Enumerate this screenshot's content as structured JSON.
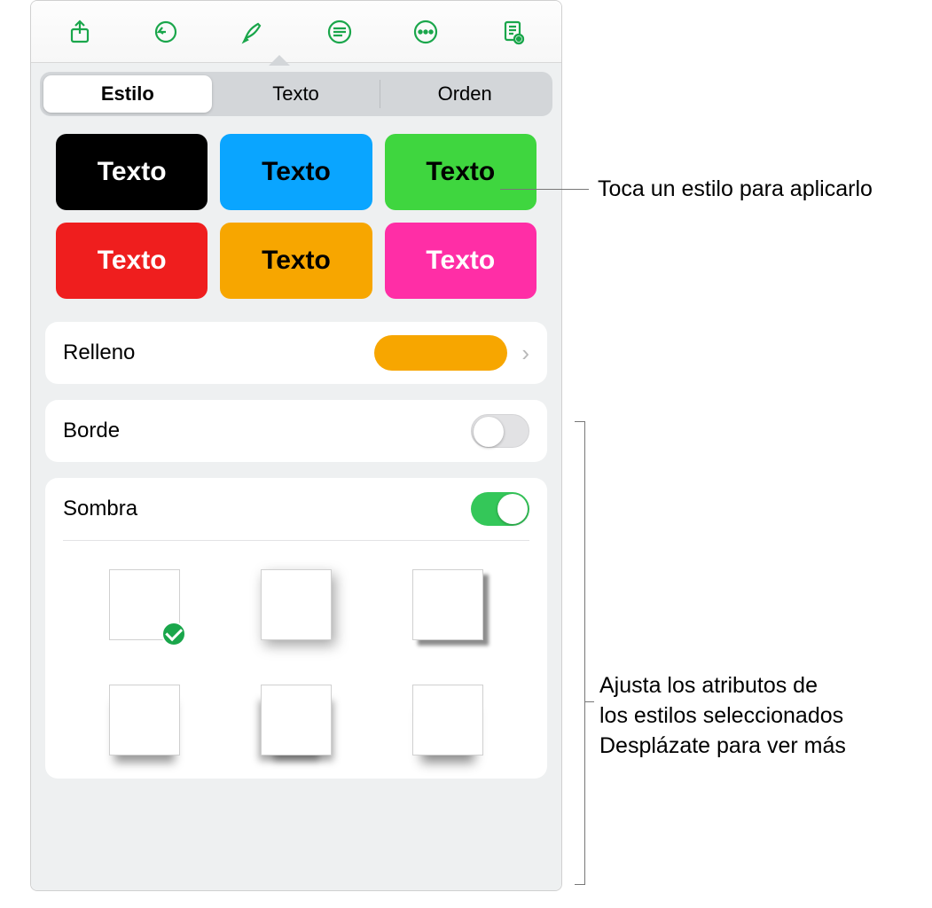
{
  "toolbar": {
    "icons": [
      "share-icon",
      "undo-icon",
      "format-brush-icon",
      "justify-icon",
      "more-icon",
      "document-icon"
    ]
  },
  "tabs": {
    "items": [
      "Estilo",
      "Texto",
      "Orden"
    ],
    "active_index": 0
  },
  "style_swatches": [
    {
      "bg": "#000000",
      "fg": "#ffffff",
      "label": "Texto"
    },
    {
      "bg": "#0aa5ff",
      "fg": "#000000",
      "label": "Texto"
    },
    {
      "bg": "#3fd63f",
      "fg": "#000000",
      "label": "Texto"
    },
    {
      "bg": "#ef1e1e",
      "fg": "#ffffff",
      "label": "Texto"
    },
    {
      "bg": "#f7a600",
      "fg": "#000000",
      "label": "Texto"
    },
    {
      "bg": "#ff2ea6",
      "fg": "#ffffff",
      "label": "Texto"
    }
  ],
  "fill": {
    "label": "Relleno",
    "color": "#f7a600"
  },
  "border": {
    "label": "Borde",
    "on": false
  },
  "shadow": {
    "label": "Sombra",
    "on": true,
    "options": [
      {
        "style": "none",
        "selected": true
      },
      {
        "style": "drop-soft"
      },
      {
        "style": "drop-sharp"
      },
      {
        "style": "contact"
      },
      {
        "style": "contact-curve"
      },
      {
        "style": "below"
      }
    ]
  },
  "callouts": {
    "top": "Toca un estilo para aplicarlo",
    "bottom_line1": "Ajusta los atributos de",
    "bottom_line2": "los estilos seleccionados",
    "bottom_line3": "Desplázate para ver más"
  }
}
